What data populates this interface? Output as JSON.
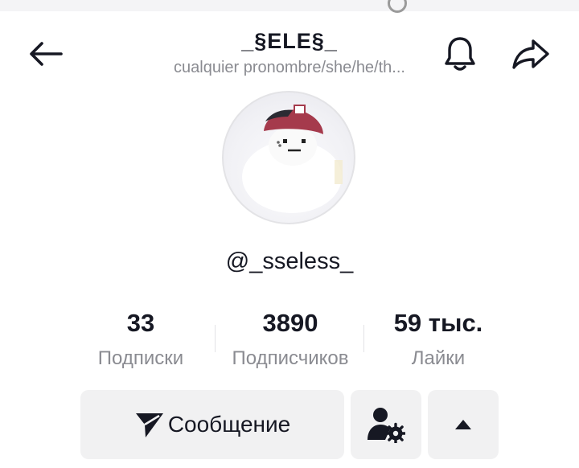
{
  "header": {
    "title": "_§ELE§_",
    "subtitle": "cualquier pronombre/she/he/th..."
  },
  "profile": {
    "username": "@_sseless_"
  },
  "stats": [
    {
      "value": "33",
      "label": "Подписки"
    },
    {
      "value": "3890",
      "label": "Подписчиков"
    },
    {
      "value": "59 тыс.",
      "label": "Лайки"
    }
  ],
  "actions": {
    "message_label": "Сообщение"
  },
  "icons": {
    "back": "arrow-left-icon",
    "notifications": "bell-icon",
    "share": "share-arrow-icon",
    "message": "send-icon",
    "user_settings": "user-gear-icon",
    "expand": "caret-up-icon"
  },
  "colors": {
    "text": "#161823",
    "secondary_text": "#8a8b91",
    "button_bg": "#f1f1f2",
    "cap": "#a53a4c"
  }
}
